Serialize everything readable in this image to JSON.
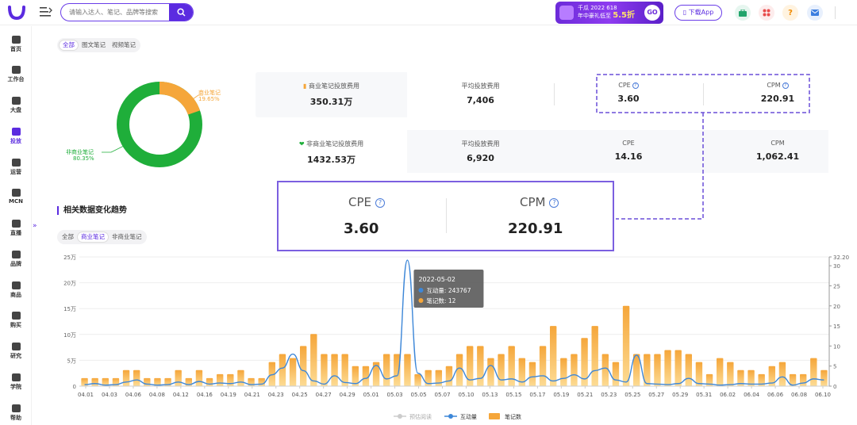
{
  "header": {
    "search_placeholder": "请输入达人、笔记、品牌等搜索",
    "promo_line1": "千瓜 2022 618",
    "promo_line2": "年中豪礼低至",
    "promo_discount": "5.5折",
    "promo_go": "GO",
    "download_label": "下载App",
    "help_label": "?",
    "brand_color": "#5b2be0"
  },
  "sidebar": {
    "items": [
      {
        "label": "首页",
        "icon": "home-icon"
      },
      {
        "label": "工作台",
        "icon": "workbench-icon"
      },
      {
        "label": "大盘",
        "icon": "pie-icon"
      },
      {
        "label": "投放",
        "icon": "folder-icon"
      },
      {
        "label": "运营",
        "icon": "chart-icon"
      },
      {
        "label": "MCN",
        "icon": "building-icon"
      },
      {
        "label": "直播",
        "icon": "video-icon"
      },
      {
        "label": "品牌",
        "icon": "brand-icon"
      },
      {
        "label": "商品",
        "icon": "bag-icon"
      },
      {
        "label": "购买",
        "icon": "cart-icon"
      },
      {
        "label": "研究",
        "icon": "flask-icon"
      },
      {
        "label": "学院",
        "icon": "cap-icon"
      },
      {
        "label": "帮助",
        "icon": "help-icon"
      }
    ],
    "expander": "»"
  },
  "top_tabs": [
    "全部",
    "图文笔记",
    "视频笔记"
  ],
  "donut": {
    "commercial_label": "商业笔记",
    "commercial_pct": "19.65%",
    "commercial_value": 19.65,
    "noncommercial_label": "非商业笔记",
    "noncommercial_pct": "80.35%",
    "noncommercial_value": 80.35,
    "commercial_color": "#f5a63a",
    "noncommercial_color": "#1fae3a"
  },
  "commercial_row": {
    "spend_label": "商业笔记投放费用",
    "spend_value": "350.31万",
    "avg_label": "平均投放费用",
    "avg_value": "7,406",
    "cpe_label": "CPE",
    "cpe_value": "3.60",
    "cpm_label": "CPM",
    "cpm_value": "220.91"
  },
  "noncommercial_row": {
    "spend_label": "非商业笔记投放费用",
    "spend_value": "1432.53万",
    "avg_label": "平均投放费用",
    "avg_value": "6,920",
    "cpe_label": "CPE",
    "cpe_value": "14.16",
    "cpm_label": "CPM",
    "cpm_value": "1,062.41"
  },
  "zoom": {
    "cpe_label": "CPE",
    "cpe_value": "3.60",
    "cpm_label": "CPM",
    "cpm_value": "220.91"
  },
  "trend": {
    "title": "相关数据变化趋势",
    "tabs": [
      "全部",
      "商业笔记",
      "非商业笔记"
    ]
  },
  "chart_data": {
    "type": "bar",
    "x_tick_labels": [
      "04.01",
      "04.03",
      "04.06",
      "04.08",
      "04.12",
      "04.16",
      "04.19",
      "04.21",
      "04.23",
      "04.25",
      "04.27",
      "04.29",
      "05.01",
      "05.03",
      "05.05",
      "05.07",
      "05.10",
      "05.13",
      "05.15",
      "05.17",
      "05.19",
      "05.21",
      "05.23",
      "05.25",
      "05.27",
      "05.29",
      "05.31",
      "06.02",
      "06.04",
      "06.06",
      "06.08",
      "06.10"
    ],
    "left_axis_ticks": [
      "0",
      "5万",
      "10万",
      "15万",
      "20万",
      "25万"
    ],
    "left_ylim": [
      0,
      250000
    ],
    "right_axis_ticks": [
      "0",
      "5",
      "10",
      "15",
      "20",
      "25",
      "30",
      "32.20"
    ],
    "right_ylim": [
      0,
      32.2
    ],
    "series": [
      {
        "name": "笔记数",
        "axis": "right",
        "kind": "bar",
        "values": [
          2,
          2,
          2,
          2,
          4,
          4,
          2,
          2,
          2,
          4,
          2,
          4,
          2,
          3,
          3,
          4,
          2,
          2,
          6,
          8,
          7,
          10,
          13,
          8,
          8,
          8,
          5,
          5,
          6,
          8,
          8,
          8,
          3,
          4,
          4,
          5,
          8,
          10,
          10,
          7,
          8,
          10,
          7,
          6,
          10,
          15,
          7,
          8,
          12,
          15,
          8,
          6,
          20,
          8,
          8,
          8,
          9,
          9,
          8,
          6,
          3,
          7,
          6,
          4,
          4,
          3,
          5,
          6,
          3,
          3,
          7,
          4
        ]
      },
      {
        "name": "互动量",
        "axis": "left",
        "kind": "line",
        "values": [
          3000,
          5000,
          2000,
          3000,
          8000,
          12000,
          4000,
          2000,
          3000,
          8000,
          3000,
          9000,
          4000,
          6000,
          5000,
          8000,
          3000,
          4000,
          22000,
          35000,
          62000,
          30000,
          10000,
          4000,
          20000,
          7000,
          5000,
          15000,
          40000,
          14000,
          20000,
          243767,
          25000,
          5000,
          6000,
          10000,
          35000,
          12000,
          15000,
          40000,
          12000,
          14000,
          8000,
          18000,
          20000,
          10000,
          15000,
          22000,
          14000,
          30000,
          35000,
          12000,
          8000,
          60000,
          5000,
          4000,
          3000,
          5000,
          15000,
          5000,
          4000,
          2000,
          3000,
          5000,
          4000,
          4000,
          6000,
          18000,
          2000,
          6000,
          14000,
          12000
        ]
      },
      {
        "name": "预估阅读",
        "axis": "left",
        "kind": "line",
        "values": []
      }
    ],
    "tooltip": {
      "date": "2022-05-02",
      "line1": "互动量: 243767",
      "line2": "笔记数: 12"
    },
    "legend": [
      "预估阅读",
      "互动量",
      "笔记数"
    ],
    "legend_position": "bottom",
    "bar_color_top": "#f5a63a",
    "bar_color_bottom": "#fddc95",
    "line_color": "#3d87d8"
  }
}
